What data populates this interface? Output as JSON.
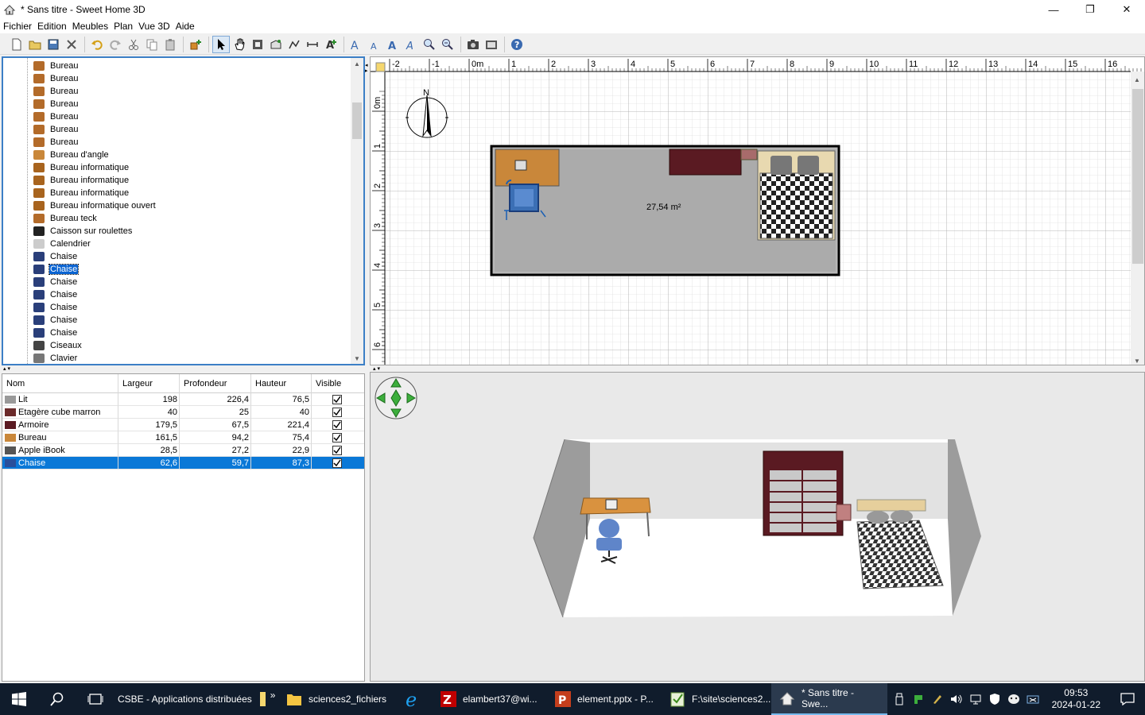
{
  "window": {
    "title": "* Sans titre - Sweet Home 3D",
    "minimize_glyph": "—",
    "maximize_glyph": "❐",
    "close_glyph": "✕"
  },
  "menu": [
    "Fichier",
    "Edition",
    "Meubles",
    "Plan",
    "Vue 3D",
    "Aide"
  ],
  "toolbar": {
    "buttons": [
      "new-icon",
      "open-icon",
      "save-icon",
      "cut-prefs-icon",
      "undo-icon",
      "redo-icon",
      "cut-icon",
      "copy-icon",
      "paste-icon",
      "add-furniture-icon",
      "select-icon",
      "pan-icon",
      "create-walls-icon",
      "create-rooms-icon",
      "create-polylines-icon",
      "create-dimensions-icon",
      "create-labels-icon",
      "increase-text-icon",
      "decrease-text-icon",
      "bold-text-icon",
      "italic-text-icon",
      "zoom-in-icon",
      "zoom-out-icon",
      "create-photo-icon",
      "create-video-icon",
      "help-icon"
    ]
  },
  "catalog": {
    "items": [
      {
        "label": "Bureau",
        "icon": "desk-icon"
      },
      {
        "label": "Bureau",
        "icon": "desk-icon"
      },
      {
        "label": "Bureau",
        "icon": "desk-icon"
      },
      {
        "label": "Bureau",
        "icon": "desk-icon"
      },
      {
        "label": "Bureau",
        "icon": "desk-icon"
      },
      {
        "label": "Bureau",
        "icon": "desk-icon"
      },
      {
        "label": "Bureau",
        "icon": "desk-icon"
      },
      {
        "label": "Bureau d'angle",
        "icon": "corner-desk-icon"
      },
      {
        "label": "Bureau informatique",
        "icon": "computer-desk-icon"
      },
      {
        "label": "Bureau informatique",
        "icon": "computer-desk-icon"
      },
      {
        "label": "Bureau informatique",
        "icon": "computer-desk-icon"
      },
      {
        "label": "Bureau informatique ouvert",
        "icon": "computer-desk-icon"
      },
      {
        "label": "Bureau teck",
        "icon": "desk-icon"
      },
      {
        "label": "Caisson sur roulettes",
        "icon": "drawer-unit-icon"
      },
      {
        "label": "Calendrier",
        "icon": "calendar-icon"
      },
      {
        "label": "Chaise",
        "icon": "chair-icon"
      },
      {
        "label": "Chaise",
        "icon": "chair-icon",
        "selected": true
      },
      {
        "label": "Chaise",
        "icon": "chair-icon"
      },
      {
        "label": "Chaise",
        "icon": "chair-icon"
      },
      {
        "label": "Chaise",
        "icon": "chair-icon"
      },
      {
        "label": "Chaise",
        "icon": "chair-icon"
      },
      {
        "label": "Chaise",
        "icon": "chair-icon"
      },
      {
        "label": "Ciseaux",
        "icon": "scissors-icon"
      },
      {
        "label": "Clavier",
        "icon": "keyboard-icon"
      }
    ]
  },
  "furniture_table": {
    "headers": [
      "Nom",
      "Largeur",
      "Profondeur",
      "Hauteur",
      "Visible"
    ],
    "rows": [
      {
        "name": "Lit",
        "largeur": "198",
        "profondeur": "226,4",
        "hauteur": "76,5",
        "visible": true
      },
      {
        "name": "Etagère cube marron",
        "largeur": "40",
        "profondeur": "25",
        "hauteur": "40",
        "visible": true
      },
      {
        "name": "Armoire",
        "largeur": "179,5",
        "profondeur": "67,5",
        "hauteur": "221,4",
        "visible": true
      },
      {
        "name": "Bureau",
        "largeur": "161,5",
        "profondeur": "94,2",
        "hauteur": "75,4",
        "visible": true
      },
      {
        "name": "Apple iBook",
        "largeur": "28,5",
        "profondeur": "27,2",
        "hauteur": "22,9",
        "visible": true
      },
      {
        "name": "Chaise",
        "largeur": "62,6",
        "profondeur": "59,7",
        "hauteur": "87,3",
        "visible": true,
        "selected": true
      }
    ]
  },
  "plan": {
    "ruler_x": [
      "-2",
      "-1",
      "0m",
      "1",
      "2",
      "3",
      "4",
      "5",
      "6",
      "7",
      "8",
      "9",
      "10",
      "11",
      "12",
      "13",
      "14",
      "15",
      "16"
    ],
    "ruler_y": [
      "0m",
      "1",
      "2",
      "3",
      "4",
      "5",
      "6"
    ],
    "compass_label": "N",
    "room_area": "27,54 m²"
  },
  "taskbar": {
    "search_icon": "search-icon",
    "items": [
      {
        "label": "CSBE - Applications distribuées",
        "icon": "folder-icon"
      },
      {
        "label": "sciences2_fichiers",
        "icon": "folder-icon"
      },
      {
        "label": "",
        "icon": "internet-explorer-icon"
      },
      {
        "label": "elambert37@wi...",
        "icon": "filezilla-icon"
      },
      {
        "label": "element.pptx - P...",
        "icon": "powerpoint-icon"
      },
      {
        "label": "F:\\site\\sciences2...",
        "icon": "notepad-icon"
      },
      {
        "label": "* Sans titre - Swe...",
        "icon": "sweet-home-icon",
        "active": true
      }
    ],
    "overflow": "»",
    "time": "09:53",
    "date": "2024-01-22"
  }
}
